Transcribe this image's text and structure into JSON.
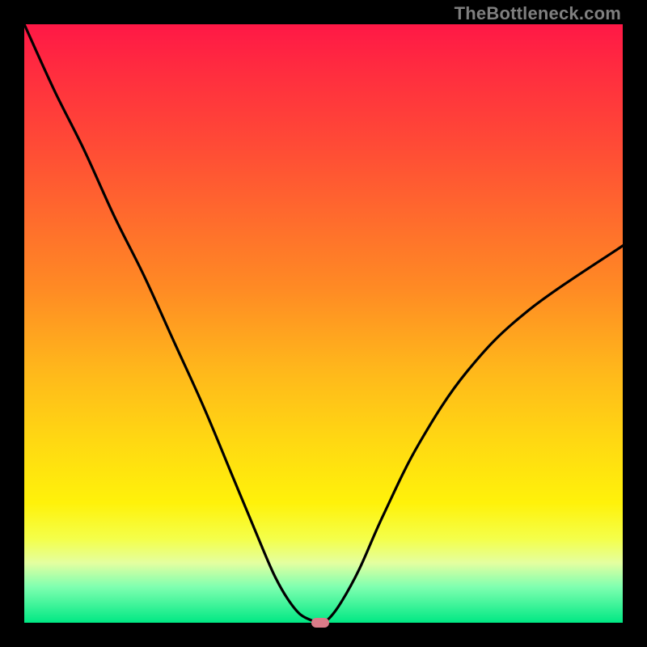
{
  "watermark": "TheBottleneck.com",
  "colors": {
    "frame": "#000000",
    "gradient_top": "#ff1846",
    "gradient_bottom": "#00e884",
    "curve": "#000000",
    "marker": "#d97b88",
    "watermark": "#7f7f7f"
  },
  "chart_data": {
    "type": "line",
    "title": "",
    "xlabel": "",
    "ylabel": "",
    "xlim": [
      0,
      100
    ],
    "ylim": [
      0,
      100
    ],
    "grid": false,
    "legend": false,
    "series": [
      {
        "name": "bottleneck-curve",
        "x": [
          0,
          5,
          10,
          15,
          20,
          25,
          30,
          35,
          40,
          42,
          44,
          46,
          48,
          49.5,
          51,
          53,
          56,
          60,
          66,
          74,
          84,
          100
        ],
        "y": [
          100,
          89,
          79,
          68,
          58,
          47,
          36,
          24,
          12,
          7.5,
          4,
          1.5,
          0.4,
          0,
          0.8,
          3.5,
          9,
          18,
          30,
          42,
          52,
          63
        ]
      }
    ],
    "marker": {
      "x": 49.5,
      "y": 0
    },
    "annotations": []
  }
}
